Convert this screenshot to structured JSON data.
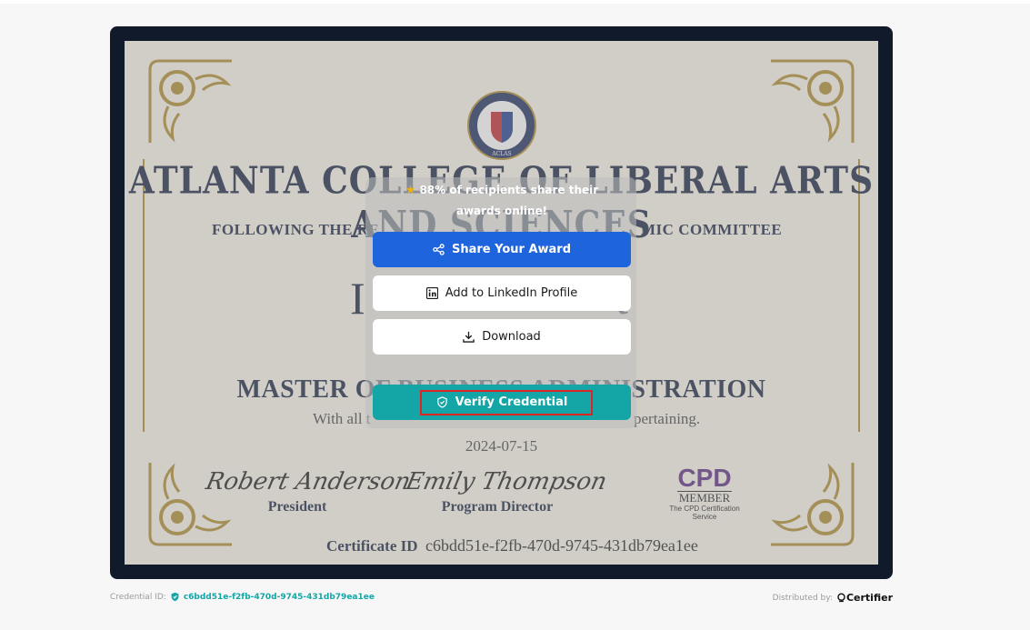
{
  "certificate": {
    "college_name": "ATLANTA COLLEGE OF LIBERAL ARTS AND SCIENCES",
    "seal_text": "ACLAS",
    "following_left": "FOLLOWING THE RE",
    "following_right": "MIC COMMITTEE",
    "recipient_left": "I",
    "recipient_right": "t",
    "degree": "MASTER OF BUSINESS ADMINISTRATION",
    "with_all_left": "With all t",
    "with_all_right": "pertaining.",
    "date": "2024-07-15",
    "signature_1": "Robert Anderson",
    "role_1": "President",
    "signature_2": "Emily Thompson",
    "role_2": "Program Director",
    "cpd_big": "CPD",
    "cpd_member": "MEMBER",
    "cpd_sub": "The CPD Certification Service",
    "certificate_id_label": "Certificate ID",
    "certificate_id_value": "c6bdd51e-f2fb-470d-9745-431db79ea1ee"
  },
  "popup": {
    "banner_text": "88% of recipients share their awards online!",
    "share_label": "Share Your Award",
    "linkedin_label": "Add to LinkedIn Profile",
    "download_label": "Download",
    "verify_label": "Verify Credential"
  },
  "footer": {
    "credential_id_label": "Credential ID:",
    "credential_id_value": "c6bdd51e-f2fb-470d-9745-431db79ea1ee",
    "distributed_label": "Distributed by:",
    "brand_name": "Certifier"
  },
  "icons": {
    "star": "star-icon",
    "share": "share-icon",
    "linkedin": "linkedin-icon",
    "download": "download-icon",
    "verify": "shield-check-icon"
  },
  "colors": {
    "frame": "#111a2b",
    "share_button": "#1e64dc",
    "verify_button": "#14a6a6",
    "highlight": "#e02424",
    "gold": "#b08a2e"
  }
}
